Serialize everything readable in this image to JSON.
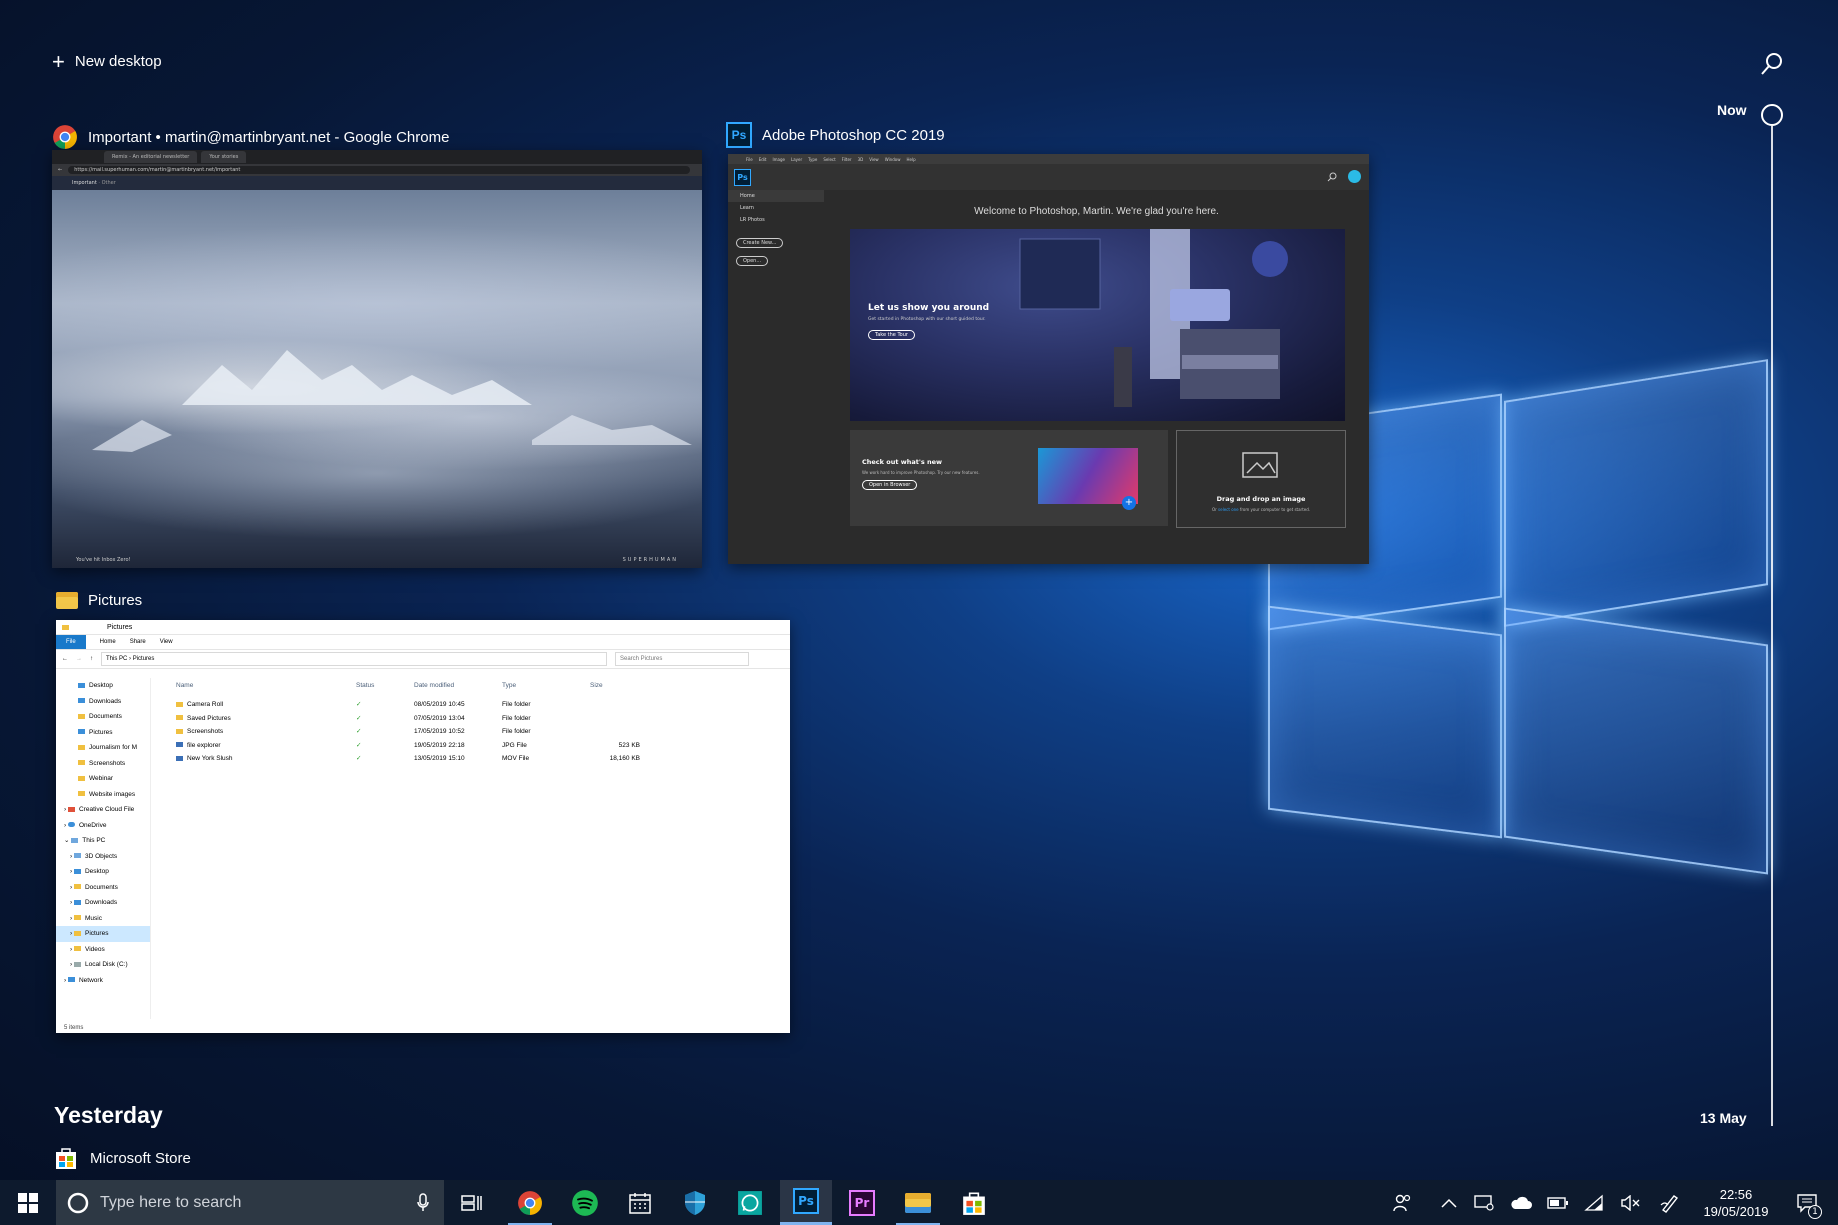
{
  "top": {
    "new_desktop_plus": "+",
    "new_desktop_label": "New desktop"
  },
  "windows": [
    {
      "title": "Important • martin@martinbryant.net - Google Chrome",
      "icon": "chrome-icon"
    },
    {
      "title": "Adobe Photoshop CC 2019",
      "icon": "photoshop-icon"
    },
    {
      "title": "Pictures",
      "icon": "folder-icon"
    }
  ],
  "chrome": {
    "tabs": [
      "Remix - An editorial newsletter",
      "Your stories"
    ],
    "url": "https://mail.superhuman.com/martin@martinbryant.net/important",
    "mail_header_left": "Important",
    "mail_header_right": "Other",
    "footer_left": "You've hit Inbox Zero!",
    "footer_right": "SUPERHUMAN"
  },
  "photoshop": {
    "logo": "Ps",
    "menu": [
      "File",
      "Edit",
      "Image",
      "Layer",
      "Type",
      "Select",
      "Filter",
      "3D",
      "View",
      "Window",
      "Help"
    ],
    "sidebar": [
      "Home",
      "Learn",
      "LR Photos"
    ],
    "create_new": "Create New...",
    "open": "Open...",
    "welcome": "Welcome to Photoshop, Martin. We're glad you're here.",
    "hero_title": "Let us show you around",
    "hero_sub": "Get started in Photoshop with our short guided tour.",
    "hero_btn": "Take the Tour",
    "card1_title": "Check out what's new",
    "card1_sub": "We work hard to improve Photoshop. Try our new features.",
    "card1_btn": "Open in Browser",
    "card2_title": "Drag and drop an image",
    "card2_sub_a": "Or",
    "card2_sub_link": "select one",
    "card2_sub_b": "from your computer to get started."
  },
  "explorer": {
    "title": "Pictures",
    "ribbon": [
      "File",
      "Home",
      "Share",
      "View"
    ],
    "path": [
      "This PC",
      "Pictures"
    ],
    "search_placeholder": "Search Pictures",
    "nav": [
      "Desktop",
      "Downloads",
      "Documents",
      "Pictures",
      "Journalism for M",
      "Screenshots",
      "Webinar",
      "Website images",
      "Creative Cloud File",
      "OneDrive",
      "This PC",
      "3D Objects",
      "Desktop",
      "Documents",
      "Downloads",
      "Music",
      "Pictures",
      "Videos",
      "Local Disk (C:)",
      "Network"
    ],
    "columns": [
      "Name",
      "Status",
      "Date modified",
      "Type",
      "Size"
    ],
    "rows": [
      {
        "name": "Camera Roll",
        "status": "✓",
        "date": "08/05/2019 10:45",
        "type": "File folder",
        "size": ""
      },
      {
        "name": "Saved Pictures",
        "status": "✓",
        "date": "07/05/2019 13:04",
        "type": "File folder",
        "size": ""
      },
      {
        "name": "Screenshots",
        "status": "✓",
        "date": "17/05/2019 10:52",
        "type": "File folder",
        "size": ""
      },
      {
        "name": "file explorer",
        "status": "✓",
        "date": "19/05/2019 22:18",
        "type": "JPG File",
        "size": "523 KB"
      },
      {
        "name": "New York Slush",
        "status": "✓",
        "date": "13/05/2019 15:10",
        "type": "MOV File",
        "size": "18,160 KB"
      }
    ],
    "status_bar": "5 items"
  },
  "timeline": {
    "now": "Now",
    "yesterday": "Yesterday",
    "date_marker": "13 May",
    "yesterday_item": "Microsoft Store"
  },
  "taskbar": {
    "search_placeholder": "Type here to search",
    "time": "22:56",
    "date": "19/05/2019",
    "apps": [
      "chrome-icon",
      "spotify-icon",
      "calendar-icon",
      "defender-icon",
      "whatsapp-icon",
      "photoshop-icon",
      "premiere-icon",
      "file-explorer-icon",
      "store-icon"
    ],
    "ps_label": "Ps",
    "pr_label": "Pr",
    "notification_count": "1"
  }
}
